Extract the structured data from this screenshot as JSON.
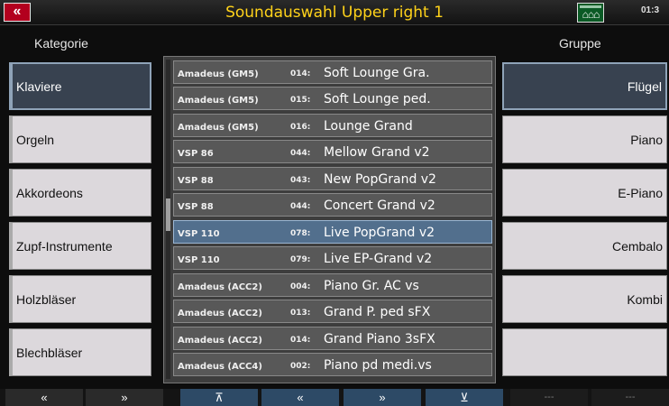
{
  "header": {
    "back_symbol": "«",
    "title": "Soundauswahl Upper right 1",
    "status_icon_glyph": "⌂⌂⌂",
    "clock": "01:3"
  },
  "headers": {
    "category": "Kategorie",
    "group": "Gruppe"
  },
  "categories": [
    "Klaviere",
    "Orgeln",
    "Akkordeons",
    "Zupf-Instrumente",
    "Holzbläser",
    "Blechbläser"
  ],
  "selected_category": "Klaviere",
  "sounds": [
    {
      "source": "Amadeus (GM5)",
      "number": "014:",
      "name": "Soft Lounge Gra."
    },
    {
      "source": "Amadeus (GM5)",
      "number": "015:",
      "name": "Soft Lounge ped."
    },
    {
      "source": "Amadeus (GM5)",
      "number": "016:",
      "name": "Lounge Grand"
    },
    {
      "source": "VSP 86",
      "number": "044:",
      "name": "Mellow Grand v2"
    },
    {
      "source": "VSP 88",
      "number": "043:",
      "name": "New PopGrand v2"
    },
    {
      "source": "VSP 88",
      "number": "044:",
      "name": "Concert Grand v2"
    },
    {
      "source": "VSP 110",
      "number": "078:",
      "name": "Live PopGrand v2"
    },
    {
      "source": "VSP 110",
      "number": "079:",
      "name": "Live EP-Grand v2"
    },
    {
      "source": "Amadeus (ACC2)",
      "number": "004:",
      "name": "Piano Gr. AC vs"
    },
    {
      "source": "Amadeus (ACC2)",
      "number": "013:",
      "name": "Grand P. ped sFX"
    },
    {
      "source": "Amadeus (ACC2)",
      "number": "014:",
      "name": "Grand Piano 3sFX"
    },
    {
      "source": "Amadeus (ACC4)",
      "number": "002:",
      "name": "Piano pd medi.vs"
    }
  ],
  "selected_sound": "Live PopGrand v2",
  "groups": [
    "Flügel",
    "Piano",
    "E-Piano",
    "Cembalo",
    "Kombi",
    ""
  ],
  "selected_group": "Flügel",
  "bottom": {
    "cat_up": "«",
    "cat_down": "»",
    "list_top": "⊼",
    "list_up": "«",
    "list_down": "»",
    "list_bottom": "⊻",
    "grp_up": "---",
    "grp_down": "---"
  },
  "colors": {
    "accent_title": "#ffd21a",
    "selected_row": "#526f8d",
    "back_button": "#b3001e"
  }
}
